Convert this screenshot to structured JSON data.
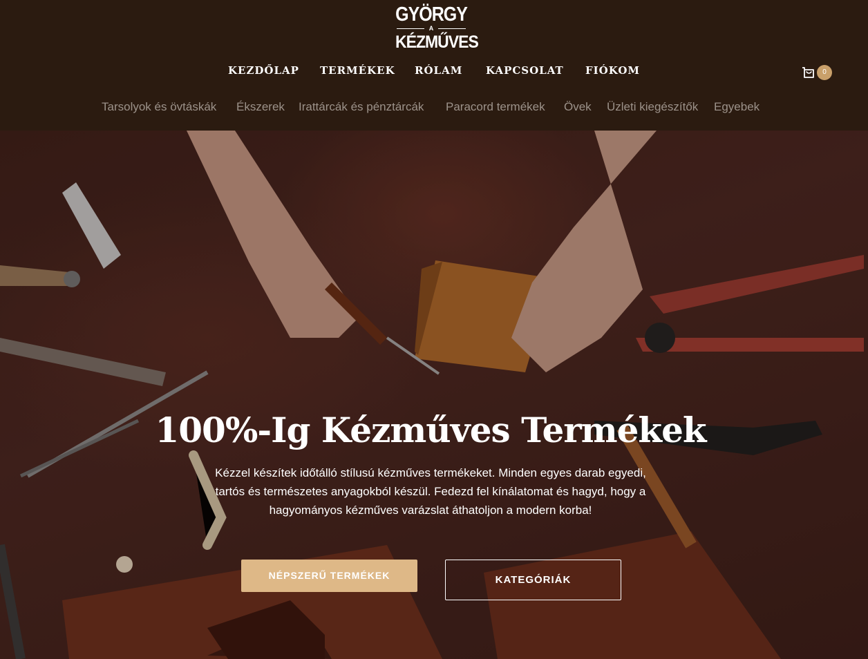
{
  "brand": {
    "line1": "GYÖRGY",
    "line_mid": "A",
    "line2": "KÉZMŰVES"
  },
  "main_nav": [
    {
      "label": "KEZDŐLAP"
    },
    {
      "label": "TERMÉKEK"
    },
    {
      "label": "RÓLAM"
    },
    {
      "label": "KAPCSOLAT"
    },
    {
      "label": "FIÓKOM"
    }
  ],
  "cart": {
    "icon": "cart-icon",
    "count": "0"
  },
  "sub_nav": [
    {
      "label": "Tarsolyok és övtáskák"
    },
    {
      "label": "Ékszerek"
    },
    {
      "label": "Irattárcák és pénztárcák"
    },
    {
      "label": "Paracord termékek"
    },
    {
      "label": "Övek"
    },
    {
      "label": "Üzleti kiegészítők"
    },
    {
      "label": "Egyebek"
    }
  ],
  "hero": {
    "title": "100%-Ig Kézműves Termékek",
    "text": "Kézzel készítek időtálló stílusú kézműves termékeket. Minden egyes darab egyedi, tartós és természetes anyagokból készül. Fedezd fel kínálatomat és hagyd, hogy a hagyományos kézműves varázslat áthatoljon a modern korba!",
    "primary_button": "NÉPSZERŰ TERMÉKEK",
    "secondary_button": "KATEGÓRIÁK"
  },
  "colors": {
    "header_bg": "#2b1b10",
    "accent": "#deb887",
    "cart_badge": "#c9a06a"
  }
}
